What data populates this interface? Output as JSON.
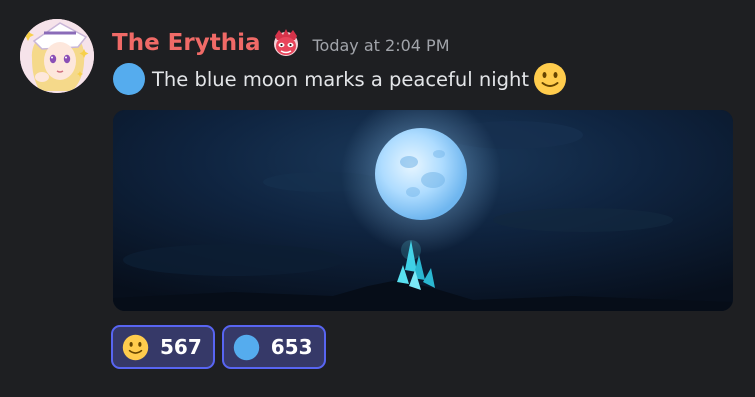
{
  "message": {
    "author": {
      "username": "The Erythia",
      "username_color": "#f06a67",
      "avatar_icon": "anime-avatar",
      "role_icon": "red-mask-role-icon"
    },
    "timestamp": "Today at 2:04 PM",
    "content": {
      "leading_emoji": "blue-circle-emoji",
      "text": "The blue moon marks a peaceful night",
      "trailing_emoji": "slightly-smiling-face-emoji"
    },
    "attachment": {
      "type": "image",
      "subject": "blue-full-moon-over-crystal-peak"
    },
    "reactions": [
      {
        "emoji": "slightly-smiling-face-emoji",
        "count": "567"
      },
      {
        "emoji": "blue-circle-emoji",
        "count": "653"
      }
    ]
  },
  "colors": {
    "background": "#1e1f22",
    "reaction_border": "#5865f2",
    "reaction_background": "#363968",
    "timestamp": "#a1a4aa",
    "message_text": "#e3e5e8"
  }
}
